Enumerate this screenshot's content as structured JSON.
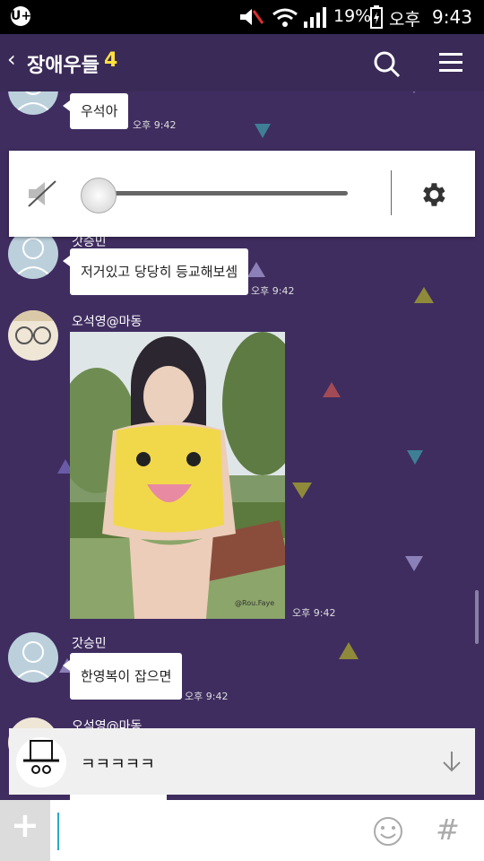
{
  "status": {
    "carrier_icon": "U+",
    "battery": "19%",
    "ampm": "오후",
    "time": "9:43"
  },
  "header": {
    "back_icon": "‹",
    "title": "장애우들",
    "member_count": "4"
  },
  "messages": [
    {
      "name": "",
      "text": "우석아",
      "time": "오후 9:42"
    },
    {
      "name": "갓승민",
      "text": "저거있고 당당히 등교해보셈",
      "time": "오후 9:42"
    },
    {
      "name": "오석영@마동",
      "text": "",
      "time": "오후 9:42"
    },
    {
      "name": "갓승민",
      "text": "한영복이 잡으면",
      "time": "오후 9:42"
    },
    {
      "name": "오석영@마동",
      "text": "",
      "time": ""
    }
  ],
  "photo": {
    "watermark": "@Rou.Faye"
  },
  "notification": {
    "text": "ㅋㅋㅋㅋㅋ"
  },
  "input": {
    "plus_label": "+",
    "placeholder": "",
    "hash_label": "#"
  },
  "colors": {
    "chat_bg": "#3f2d60",
    "header_bg": "#3a2a57",
    "count_accent": "#ffe13d"
  }
}
